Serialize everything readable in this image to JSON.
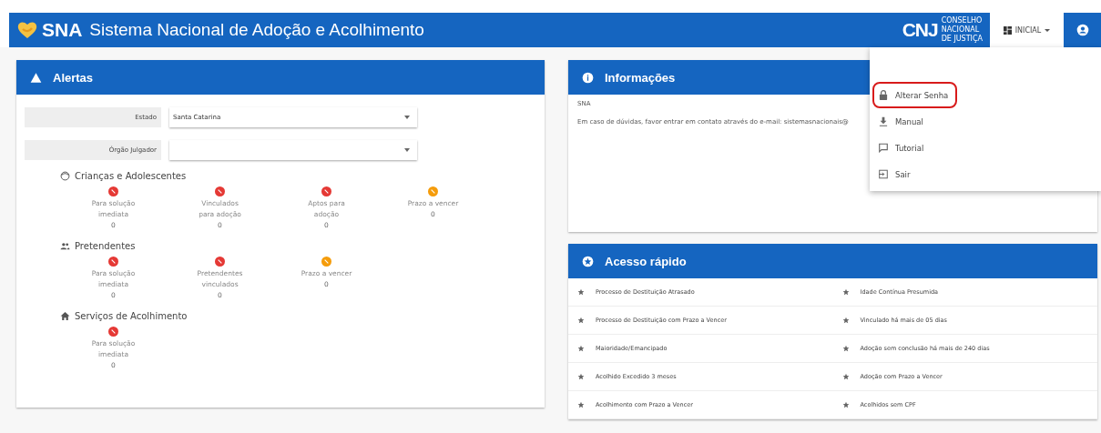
{
  "header": {
    "logo_text": "SNA",
    "title": "Sistema Nacional de Adoção e Acolhimento",
    "org_logo": {
      "initials": "CNJ",
      "lines": [
        "CONSELHO",
        "NACIONAL",
        "DE JUSTIÇA"
      ]
    },
    "menu_button": "INICIAL"
  },
  "user_menu": {
    "items": [
      {
        "label": "Alterar Senha",
        "highlighted": true
      },
      {
        "label": "Manual",
        "highlighted": false
      },
      {
        "label": "Tutorial",
        "highlighted": false
      },
      {
        "label": "Sair",
        "highlighted": false
      }
    ]
  },
  "alertas": {
    "title": "Alertas",
    "filters": [
      {
        "label": "Estado",
        "value": "Santa Catarina"
      },
      {
        "label": "Órgão Julgador"
      }
    ],
    "groups": [
      {
        "title": "Crianças e Adolescentes",
        "items": [
          {
            "color": "#e53935",
            "label": "Para solução imediata",
            "count": "0"
          },
          {
            "color": "#e53935",
            "label": "Vinculados para adoção",
            "count": "0"
          },
          {
            "color": "#e53935",
            "label": "Aptos para adoção",
            "count": "0"
          },
          {
            "color": "#f59c0b",
            "label": "Prazo a vencer",
            "count": "0"
          }
        ]
      },
      {
        "title": "Pretendentes",
        "items": [
          {
            "color": "#e53935",
            "label": "Para solução imediata",
            "count": "0"
          },
          {
            "color": "#e53935",
            "label": "Pretendentes vinculados",
            "count": "0"
          },
          {
            "color": "#f59c0b",
            "label": "Prazo a vencer",
            "count": "0"
          }
        ]
      },
      {
        "title": "Serviços de Acolhimento",
        "items": [
          {
            "color": "#e53935",
            "label": "Para solução imediata",
            "count": "0"
          }
        ]
      }
    ]
  },
  "informacoes": {
    "title": "Informações",
    "lines": [
      "SNA",
      "Em caso de dúvidas, favor entrar em contato através do e-mail: sistemasnacionais@"
    ]
  },
  "acesso_rapido": {
    "title": "Acesso rápido",
    "links": [
      "Processo de Destituição Atrasado",
      "Idade Contínua Presumida",
      "Processo de Destituição com Prazo a Vencer",
      "Vinculado há mais de 05 dias",
      "Maioridade/Emancipado",
      "Adoção sem conclusão há mais de 240 dias",
      "Acolhido Excedido 3 meses",
      "Adoção com Prazo a Vencer",
      "Acolhimento com Prazo a Vencer",
      "Acolhidos sem CPF"
    ]
  }
}
